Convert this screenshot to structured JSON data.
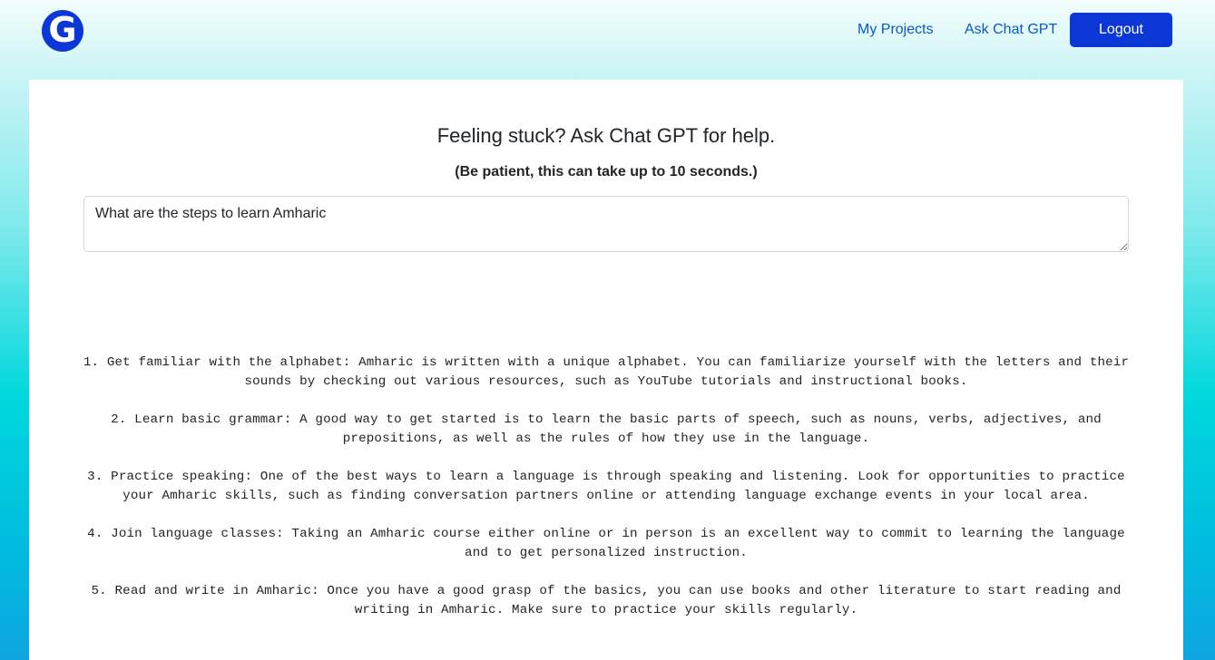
{
  "brand": {
    "logo_letter": "G"
  },
  "nav": {
    "my_projects": "My Projects",
    "ask_chat_gpt": "Ask Chat GPT",
    "logout": "Logout"
  },
  "main": {
    "heading": "Feeling stuck? Ask Chat GPT for help.",
    "subheading": "(Be patient, this can take up to 10 seconds.)",
    "prompt_value": "What are the steps to learn Amharic",
    "answer_items": [
      "1. Get familiar with the alphabet: Amharic is written with a unique alphabet. You can familiarize yourself with the letters and their sounds by checking out various resources, such as YouTube tutorials and instructional books.",
      "2. Learn basic grammar: A good way to get started is to learn the basic parts of speech, such as nouns, verbs, adjectives, and prepositions, as well as the rules of how they use in the language.",
      "3. Practice speaking: One of the best ways to learn a language is through speaking and listening. Look for opportunities to practice your Amharic skills, such as finding conversation partners online or attending language exchange events in your local area.",
      "4. Join language classes: Taking an Amharic course either online or in person is an excellent way to commit to learning the language and to get personalized instruction.",
      "5. Read and write in Amharic: Once you have a good grasp of the basics, you can use books and other literature to start reading and writing in Amharic. Make sure to practice your skills regularly."
    ]
  },
  "colors": {
    "brand_blue": "#0b37d6",
    "link_blue": "#0a58ca",
    "gradient_top": "#f4fdfd",
    "gradient_mid": "#00d8dd",
    "gradient_bottom": "#0ea5e0"
  }
}
